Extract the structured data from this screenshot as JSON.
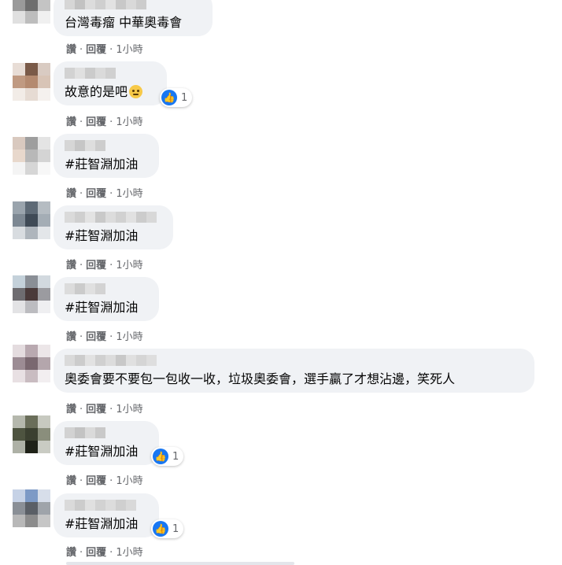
{
  "colors": {
    "bubble": "#f0f2f5",
    "accent": "#1877f2",
    "meta": "#65676b"
  },
  "action_labels": {
    "like": "讚",
    "reply": "回覆",
    "dot": "·"
  },
  "comments": [
    {
      "text": "台灣毒瘤 中華奧毒會",
      "time": "1小時",
      "reactions": null
    },
    {
      "text": "故意的是吧",
      "emoji": "face-with-rolling-eyes-emoji",
      "time": "1小時",
      "reactions": "1"
    },
    {
      "text": "#莊智淵加油",
      "time": "1小時",
      "reactions": null
    },
    {
      "text": "#莊智淵加油",
      "time": "1小時",
      "reactions": null
    },
    {
      "text": "#莊智淵加油",
      "time": "1小時",
      "reactions": null
    },
    {
      "text": "奧委會要不要包一包收一收，垃圾奧委會，選手贏了才想沾邊，笑死人",
      "time": "1小時",
      "reactions": null
    },
    {
      "text": "#莊智淵加油",
      "time": "1小時",
      "reactions": "1"
    },
    {
      "text": "#莊智淵加油",
      "time": "1小時",
      "reactions": "1"
    }
  ]
}
